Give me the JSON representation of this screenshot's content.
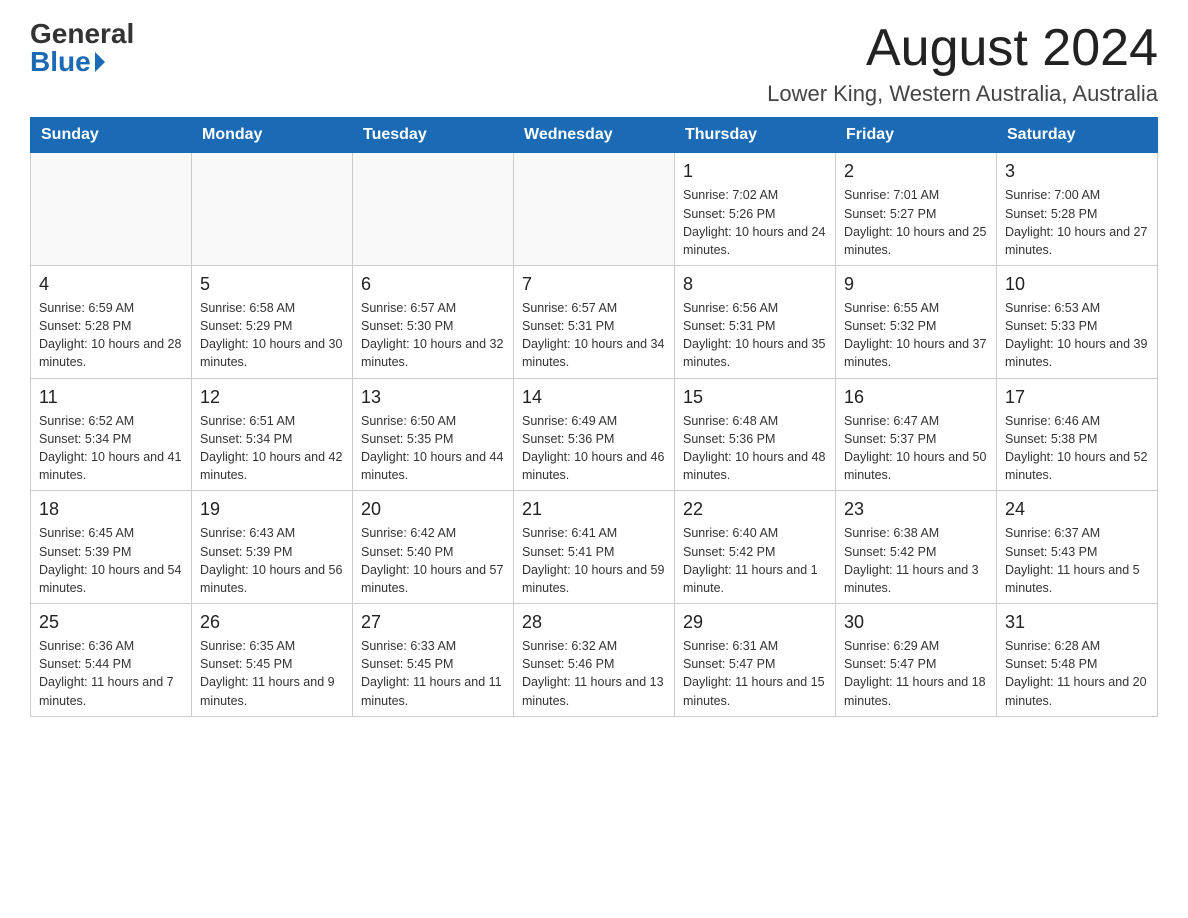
{
  "header": {
    "logo_general": "General",
    "logo_blue": "Blue",
    "month_title": "August 2024",
    "location": "Lower King, Western Australia, Australia"
  },
  "days_of_week": [
    "Sunday",
    "Monday",
    "Tuesday",
    "Wednesday",
    "Thursday",
    "Friday",
    "Saturday"
  ],
  "weeks": [
    [
      {
        "day": "",
        "info": ""
      },
      {
        "day": "",
        "info": ""
      },
      {
        "day": "",
        "info": ""
      },
      {
        "day": "",
        "info": ""
      },
      {
        "day": "1",
        "info": "Sunrise: 7:02 AM\nSunset: 5:26 PM\nDaylight: 10 hours and 24 minutes."
      },
      {
        "day": "2",
        "info": "Sunrise: 7:01 AM\nSunset: 5:27 PM\nDaylight: 10 hours and 25 minutes."
      },
      {
        "day": "3",
        "info": "Sunrise: 7:00 AM\nSunset: 5:28 PM\nDaylight: 10 hours and 27 minutes."
      }
    ],
    [
      {
        "day": "4",
        "info": "Sunrise: 6:59 AM\nSunset: 5:28 PM\nDaylight: 10 hours and 28 minutes."
      },
      {
        "day": "5",
        "info": "Sunrise: 6:58 AM\nSunset: 5:29 PM\nDaylight: 10 hours and 30 minutes."
      },
      {
        "day": "6",
        "info": "Sunrise: 6:57 AM\nSunset: 5:30 PM\nDaylight: 10 hours and 32 minutes."
      },
      {
        "day": "7",
        "info": "Sunrise: 6:57 AM\nSunset: 5:31 PM\nDaylight: 10 hours and 34 minutes."
      },
      {
        "day": "8",
        "info": "Sunrise: 6:56 AM\nSunset: 5:31 PM\nDaylight: 10 hours and 35 minutes."
      },
      {
        "day": "9",
        "info": "Sunrise: 6:55 AM\nSunset: 5:32 PM\nDaylight: 10 hours and 37 minutes."
      },
      {
        "day": "10",
        "info": "Sunrise: 6:53 AM\nSunset: 5:33 PM\nDaylight: 10 hours and 39 minutes."
      }
    ],
    [
      {
        "day": "11",
        "info": "Sunrise: 6:52 AM\nSunset: 5:34 PM\nDaylight: 10 hours and 41 minutes."
      },
      {
        "day": "12",
        "info": "Sunrise: 6:51 AM\nSunset: 5:34 PM\nDaylight: 10 hours and 42 minutes."
      },
      {
        "day": "13",
        "info": "Sunrise: 6:50 AM\nSunset: 5:35 PM\nDaylight: 10 hours and 44 minutes."
      },
      {
        "day": "14",
        "info": "Sunrise: 6:49 AM\nSunset: 5:36 PM\nDaylight: 10 hours and 46 minutes."
      },
      {
        "day": "15",
        "info": "Sunrise: 6:48 AM\nSunset: 5:36 PM\nDaylight: 10 hours and 48 minutes."
      },
      {
        "day": "16",
        "info": "Sunrise: 6:47 AM\nSunset: 5:37 PM\nDaylight: 10 hours and 50 minutes."
      },
      {
        "day": "17",
        "info": "Sunrise: 6:46 AM\nSunset: 5:38 PM\nDaylight: 10 hours and 52 minutes."
      }
    ],
    [
      {
        "day": "18",
        "info": "Sunrise: 6:45 AM\nSunset: 5:39 PM\nDaylight: 10 hours and 54 minutes."
      },
      {
        "day": "19",
        "info": "Sunrise: 6:43 AM\nSunset: 5:39 PM\nDaylight: 10 hours and 56 minutes."
      },
      {
        "day": "20",
        "info": "Sunrise: 6:42 AM\nSunset: 5:40 PM\nDaylight: 10 hours and 57 minutes."
      },
      {
        "day": "21",
        "info": "Sunrise: 6:41 AM\nSunset: 5:41 PM\nDaylight: 10 hours and 59 minutes."
      },
      {
        "day": "22",
        "info": "Sunrise: 6:40 AM\nSunset: 5:42 PM\nDaylight: 11 hours and 1 minute."
      },
      {
        "day": "23",
        "info": "Sunrise: 6:38 AM\nSunset: 5:42 PM\nDaylight: 11 hours and 3 minutes."
      },
      {
        "day": "24",
        "info": "Sunrise: 6:37 AM\nSunset: 5:43 PM\nDaylight: 11 hours and 5 minutes."
      }
    ],
    [
      {
        "day": "25",
        "info": "Sunrise: 6:36 AM\nSunset: 5:44 PM\nDaylight: 11 hours and 7 minutes."
      },
      {
        "day": "26",
        "info": "Sunrise: 6:35 AM\nSunset: 5:45 PM\nDaylight: 11 hours and 9 minutes."
      },
      {
        "day": "27",
        "info": "Sunrise: 6:33 AM\nSunset: 5:45 PM\nDaylight: 11 hours and 11 minutes."
      },
      {
        "day": "28",
        "info": "Sunrise: 6:32 AM\nSunset: 5:46 PM\nDaylight: 11 hours and 13 minutes."
      },
      {
        "day": "29",
        "info": "Sunrise: 6:31 AM\nSunset: 5:47 PM\nDaylight: 11 hours and 15 minutes."
      },
      {
        "day": "30",
        "info": "Sunrise: 6:29 AM\nSunset: 5:47 PM\nDaylight: 11 hours and 18 minutes."
      },
      {
        "day": "31",
        "info": "Sunrise: 6:28 AM\nSunset: 5:48 PM\nDaylight: 11 hours and 20 minutes."
      }
    ]
  ]
}
